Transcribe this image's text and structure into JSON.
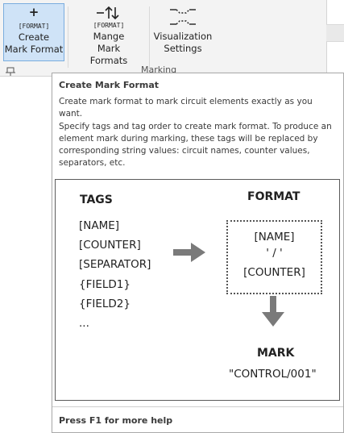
{
  "ribbon": {
    "buttons": [
      {
        "label_line1": "Create",
        "label_line2": "Mark Format",
        "icon_text": "[FORMAT]"
      },
      {
        "label_line1": "Mange",
        "label_line2": "Mark Formats",
        "icon_text": "[FORMAT]"
      },
      {
        "label_line1": "Visualization",
        "label_line2": "Settings"
      }
    ],
    "group_label": "Marking"
  },
  "tooltip": {
    "title": "Create Mark Format",
    "description": "Create mark format to mark circuit elements exactly as you want.",
    "details": "Specify tags and tag order to create mark format. To produce an element mark during marking, these tags will be replaced by corresponding string values: circuit names, counter values, separators, etc.",
    "diagram": {
      "tags_header": "TAGS",
      "tags": [
        "[NAME]",
        "[COUNTER]",
        "[SEPARATOR]",
        "{FIELD1}",
        "{FIELD2}",
        "..."
      ],
      "format_header": "FORMAT",
      "format_lines": [
        "[NAME]",
        "' / '",
        "[COUNTER]"
      ],
      "mark_header": "MARK",
      "mark_value": "\"CONTROL/001\""
    },
    "footer": "Press F1 for more help"
  },
  "colors": {
    "active_button_bg": "#cfe3f7",
    "active_button_border": "#7aaddf",
    "arrow": "#7a7a7a"
  }
}
